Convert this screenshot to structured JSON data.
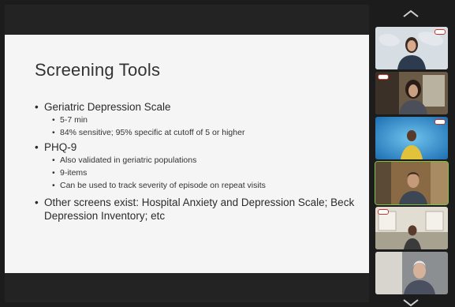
{
  "slide": {
    "title": "Screening Tools",
    "bullets": [
      {
        "text": "Geriatric Depression Scale",
        "sub": [
          "5-7 min",
          "84% sensitive; 95% specific at cutoff of 5 or higher"
        ]
      },
      {
        "text": "PHQ-9",
        "sub": [
          "Also validated in geriatric populations",
          "9-items",
          "Can be used to track severity of episode on repeat visits"
        ]
      },
      {
        "text": "Other screens exist: Hospital Anxiety and Depression Scale; Beck",
        "cont": "Depression Inventory; etc"
      }
    ]
  },
  "participants": [
    {
      "label": "participant-1",
      "active": false
    },
    {
      "label": "participant-2",
      "active": false
    },
    {
      "label": "participant-3",
      "active": false
    },
    {
      "label": "participant-4",
      "active": true
    },
    {
      "label": "participant-5",
      "active": false
    },
    {
      "label": "participant-6",
      "active": false
    }
  ],
  "icons": {
    "scroll_up": "chevron-up-icon",
    "scroll_down": "chevron-down-icon",
    "recording": "recording-badge-icon"
  },
  "colors": {
    "slide_background": "#f5f5f5",
    "active_speaker_border": "#7fc24a",
    "app_background": "#1c1c1c"
  }
}
